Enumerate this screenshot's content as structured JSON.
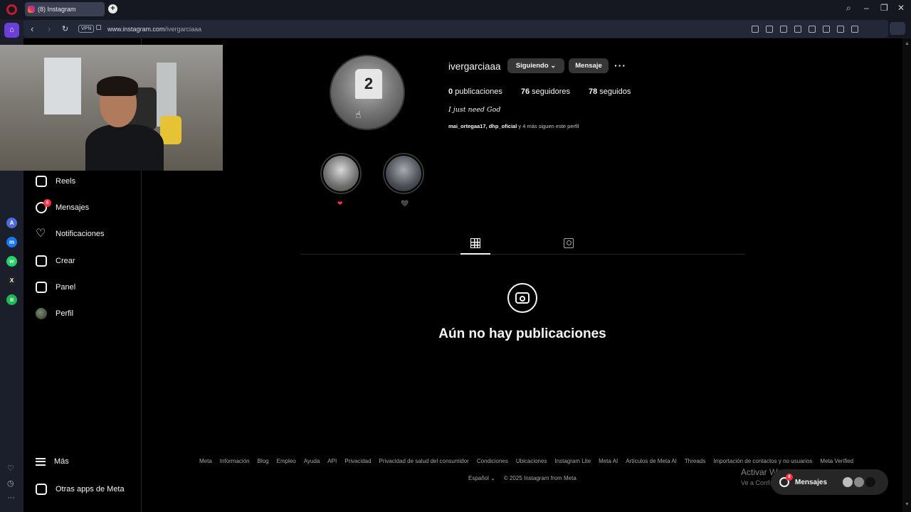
{
  "browser": {
    "tab_title": "(8) Instagram",
    "vpn_label": "VPN",
    "url_host": "www.instagram.com",
    "url_path": "/ivergarciaaa"
  },
  "nav": {
    "items": [
      {
        "label": "Reels",
        "icon": "reels-icon"
      },
      {
        "label": "Mensajes",
        "icon": "messenger-icon",
        "badge": "8"
      },
      {
        "label": "Notificaciones",
        "icon": "heart-icon"
      },
      {
        "label": "Crear",
        "icon": "plus-icon"
      },
      {
        "label": "Panel",
        "icon": "chart-icon"
      },
      {
        "label": "Perfil",
        "icon": "avatar"
      }
    ],
    "more_label": "Más",
    "meta_apps_label": "Otras apps de Meta"
  },
  "profile": {
    "username": "ivergarciaaa",
    "following_label": "Siguiendo",
    "message_label": "Mensaje",
    "more_label": "···",
    "posts_count": "0",
    "posts_label": "publicaciones",
    "followers_count": "76",
    "followers_label": "seguidores",
    "following_count": "78",
    "following_count_label": "seguidos",
    "bio": "I just need God",
    "followed_by_users": "mai_ortegaa17, dhp_oficial",
    "followed_by_rest": " y 4 más siguen este perfil",
    "jersey_number": "2"
  },
  "highlights": [
    {
      "label": "❤"
    },
    {
      "label": "🖤"
    }
  ],
  "empty_state": {
    "title": "Aún no hay publicaciones"
  },
  "footer": {
    "links": [
      "Meta",
      "Información",
      "Blog",
      "Empleo",
      "Ayuda",
      "API",
      "Privacidad",
      "Privacidad de salud del consumidor",
      "Condiciones",
      "Ubicaciones",
      "Instagram Lite",
      "Meta AI",
      "Artículos de Meta AI",
      "Threads",
      "Importación de contactos y no usuarios",
      "Meta Verified"
    ],
    "language": "Español",
    "copyright": "© 2025 Instagram from Meta"
  },
  "messages_pill": {
    "label": "Mensajes",
    "badge": "8"
  },
  "windows_watermark": {
    "line1": "Activar Windows",
    "line2": "Ve a Configuración para activar Windows."
  },
  "colors": {
    "background": "#000000",
    "badge": "#ff3040",
    "button": "#363636",
    "opera_accent": "#6b3fd8"
  }
}
